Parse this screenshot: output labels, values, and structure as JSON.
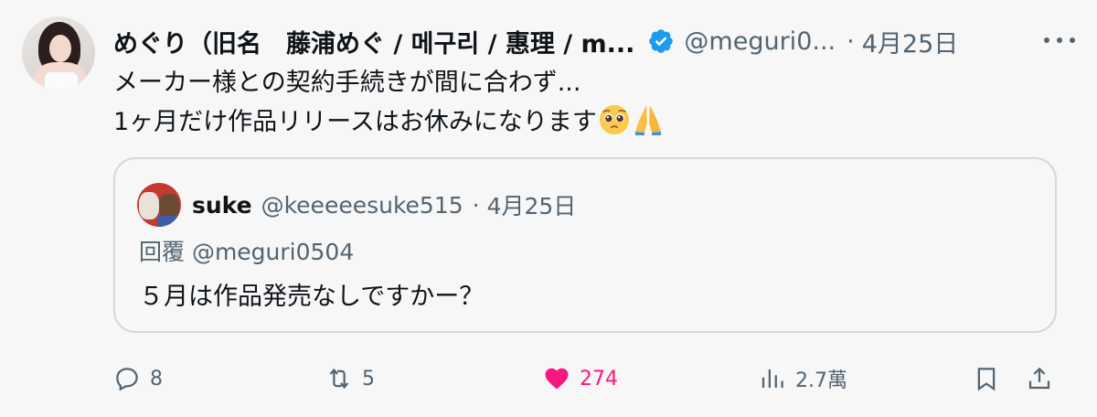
{
  "tweet": {
    "author": {
      "display_name": "めぐり（旧名　藤浦めぐ / 메구리 / 惠理 / m...",
      "handle": "@meguri0...",
      "verified": true
    },
    "separator": "·",
    "date": "4月25日",
    "text_lines": [
      "メーカー様との契約手続きが間に合わず...",
      "1ヶ月だけ作品リリースはお休みになります"
    ],
    "emojis": [
      "pleading-face",
      "folded-hands"
    ]
  },
  "quote": {
    "author": {
      "display_name": "suke",
      "handle": "@keeeeesuke515"
    },
    "separator": "·",
    "date": "4月25日",
    "reply_to": "回覆 @meguri0504",
    "text": "５月は作品発売なしですかー？"
  },
  "actions": {
    "reply_count": "8",
    "retweet_count": "5",
    "like_count": "274",
    "views_count": "2.7萬"
  },
  "colors": {
    "background": "#f7f7f7",
    "text": "#0f1419",
    "secondary": "#536471",
    "verified": "#1d9bf0",
    "like": "#f91880",
    "border": "#cfd9de"
  }
}
